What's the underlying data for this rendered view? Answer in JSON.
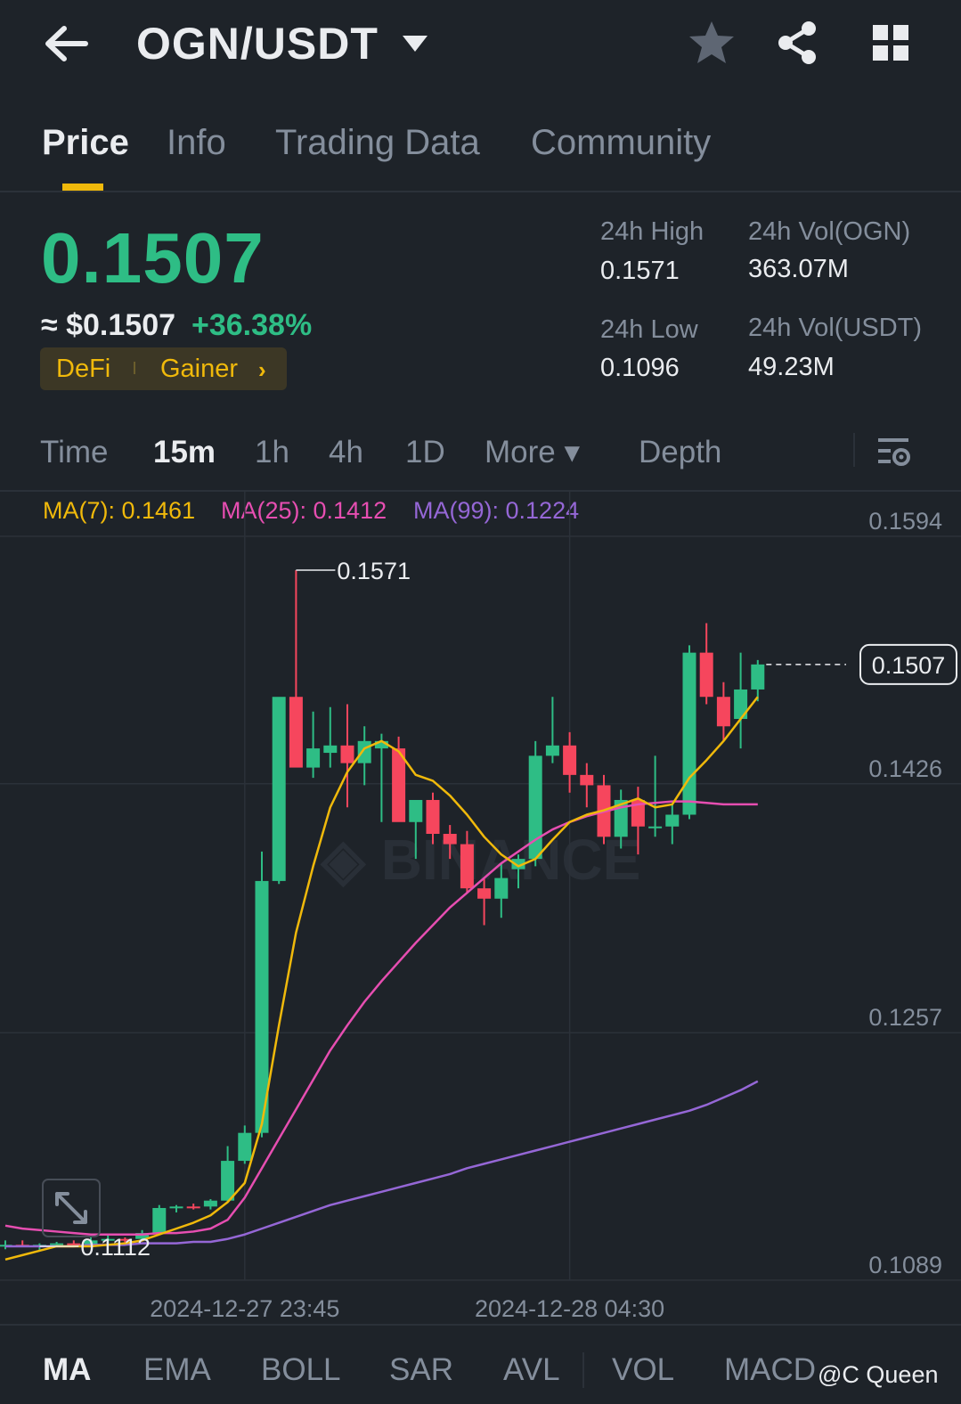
{
  "header": {
    "pair": "OGN/USDT",
    "icons": [
      "back-arrow-icon",
      "dropdown-caret-icon",
      "star-icon",
      "share-icon",
      "grid-menu-icon"
    ]
  },
  "tabs": [
    {
      "label": "Price",
      "active": true
    },
    {
      "label": "Info",
      "active": false
    },
    {
      "label": "Trading Data",
      "active": false
    },
    {
      "label": "Community",
      "active": false
    }
  ],
  "price": {
    "last": "0.1507",
    "usd": "≈ $0.1507",
    "change": "+36.38%",
    "tags": [
      "DeFi",
      "Gainer"
    ],
    "tag_chevron": "›"
  },
  "stats": {
    "high_label": "24h High",
    "high_value": "0.1571",
    "low_label": "24h Low",
    "low_value": "0.1096",
    "vol_base_label": "24h Vol(OGN)",
    "vol_base_value": "363.07M",
    "vol_quote_label": "24h Vol(USDT)",
    "vol_quote_value": "49.23M"
  },
  "intervals": [
    {
      "label": "Time",
      "active": false
    },
    {
      "label": "15m",
      "active": true
    },
    {
      "label": "1h",
      "active": false
    },
    {
      "label": "4h",
      "active": false
    },
    {
      "label": "1D",
      "active": false
    },
    {
      "label": "More ▾",
      "active": false
    },
    {
      "label": "Depth",
      "active": false
    }
  ],
  "ma_legend": {
    "ma7": "MA(7): 0.1461",
    "ma25": "MA(25): 0.1412",
    "ma99": "MA(99): 0.1224"
  },
  "colors": {
    "up": "#2ebd85",
    "down": "#f6465d",
    "accent": "#f0b90b",
    "ma7": "#f0b90b",
    "ma25": "#e64eb1",
    "ma99": "#9567d6",
    "bg": "#1e2329",
    "muted": "#848e9c"
  },
  "chart_data": {
    "type": "candlestick",
    "interval": "15m",
    "y_axis_ticks": [
      "0.1594",
      "0.1426",
      "0.1257",
      "0.1089"
    ],
    "ylim": [
      0.1089,
      0.1594
    ],
    "x_axis_ticks": [
      "2024-12-27 23:45",
      "2024-12-28 04:30"
    ],
    "x_tick_candle_index": [
      14,
      33
    ],
    "annotations": {
      "high": "0.1571",
      "low": "0.1112",
      "last": "0.1507"
    },
    "high_candle_index": 17,
    "low_candle_index": 2,
    "candles": [
      {
        "o": 0.1112,
        "h": 0.1116,
        "l": 0.111,
        "c": 0.1113
      },
      {
        "o": 0.1113,
        "h": 0.1116,
        "l": 0.1112,
        "c": 0.1112
      },
      {
        "o": 0.1112,
        "h": 0.1114,
        "l": 0.1109,
        "c": 0.1113
      },
      {
        "o": 0.1113,
        "h": 0.1115,
        "l": 0.1112,
        "c": 0.1114
      },
      {
        "o": 0.1114,
        "h": 0.1116,
        "l": 0.1112,
        "c": 0.1113
      },
      {
        "o": 0.1113,
        "h": 0.1118,
        "l": 0.1112,
        "c": 0.1116
      },
      {
        "o": 0.1116,
        "h": 0.112,
        "l": 0.1114,
        "c": 0.1117
      },
      {
        "o": 0.1117,
        "h": 0.1118,
        "l": 0.1114,
        "c": 0.1116
      },
      {
        "o": 0.1117,
        "h": 0.1123,
        "l": 0.1116,
        "c": 0.1121
      },
      {
        "o": 0.1121,
        "h": 0.114,
        "l": 0.112,
        "c": 0.1138
      },
      {
        "o": 0.1138,
        "h": 0.114,
        "l": 0.1135,
        "c": 0.1139
      },
      {
        "o": 0.1139,
        "h": 0.1141,
        "l": 0.1137,
        "c": 0.1138
      },
      {
        "o": 0.1139,
        "h": 0.1144,
        "l": 0.1137,
        "c": 0.1143
      },
      {
        "o": 0.1143,
        "h": 0.118,
        "l": 0.1142,
        "c": 0.117
      },
      {
        "o": 0.117,
        "h": 0.1194,
        "l": 0.1168,
        "c": 0.1189
      },
      {
        "o": 0.1189,
        "h": 0.138,
        "l": 0.1186,
        "c": 0.136
      },
      {
        "o": 0.136,
        "h": 0.1475,
        "l": 0.1358,
        "c": 0.1485
      },
      {
        "o": 0.1485,
        "h": 0.1571,
        "l": 0.144,
        "c": 0.1437
      },
      {
        "o": 0.1437,
        "h": 0.1475,
        "l": 0.143,
        "c": 0.145
      },
      {
        "o": 0.1447,
        "h": 0.1478,
        "l": 0.1437,
        "c": 0.1452
      },
      {
        "o": 0.1452,
        "h": 0.148,
        "l": 0.141,
        "c": 0.144
      },
      {
        "o": 0.144,
        "h": 0.1465,
        "l": 0.1425,
        "c": 0.1455
      },
      {
        "o": 0.145,
        "h": 0.146,
        "l": 0.14,
        "c": 0.1455
      },
      {
        "o": 0.145,
        "h": 0.1458,
        "l": 0.143,
        "c": 0.14
      },
      {
        "o": 0.14,
        "h": 0.1408,
        "l": 0.1375,
        "c": 0.1415
      },
      {
        "o": 0.1415,
        "h": 0.142,
        "l": 0.1385,
        "c": 0.1392
      },
      {
        "o": 0.1392,
        "h": 0.1398,
        "l": 0.1375,
        "c": 0.1385
      },
      {
        "o": 0.1385,
        "h": 0.1394,
        "l": 0.1352,
        "c": 0.1355
      },
      {
        "o": 0.1355,
        "h": 0.1362,
        "l": 0.133,
        "c": 0.1348
      },
      {
        "o": 0.1348,
        "h": 0.1372,
        "l": 0.1335,
        "c": 0.1362
      },
      {
        "o": 0.1368,
        "h": 0.1378,
        "l": 0.1355,
        "c": 0.1375
      },
      {
        "o": 0.1375,
        "h": 0.1455,
        "l": 0.137,
        "c": 0.1445
      },
      {
        "o": 0.1445,
        "h": 0.1485,
        "l": 0.144,
        "c": 0.1452
      },
      {
        "o": 0.1452,
        "h": 0.1461,
        "l": 0.142,
        "c": 0.1432
      },
      {
        "o": 0.1432,
        "h": 0.144,
        "l": 0.141,
        "c": 0.1425
      },
      {
        "o": 0.1425,
        "h": 0.1432,
        "l": 0.1385,
        "c": 0.139
      },
      {
        "o": 0.139,
        "h": 0.1422,
        "l": 0.1382,
        "c": 0.1415
      },
      {
        "o": 0.1415,
        "h": 0.1424,
        "l": 0.1378,
        "c": 0.1397
      },
      {
        "o": 0.1397,
        "h": 0.1445,
        "l": 0.139,
        "c": 0.1397
      },
      {
        "o": 0.1397,
        "h": 0.1412,
        "l": 0.1385,
        "c": 0.1405
      },
      {
        "o": 0.1405,
        "h": 0.152,
        "l": 0.1402,
        "c": 0.1515
      },
      {
        "o": 0.1515,
        "h": 0.1535,
        "l": 0.148,
        "c": 0.1485
      },
      {
        "o": 0.1485,
        "h": 0.1495,
        "l": 0.1455,
        "c": 0.1465
      },
      {
        "o": 0.147,
        "h": 0.1515,
        "l": 0.145,
        "c": 0.149
      },
      {
        "o": 0.149,
        "h": 0.151,
        "l": 0.1482,
        "c": 0.1507
      }
    ],
    "ma7": [
      0.1103,
      0.1106,
      0.1109,
      0.1112,
      0.1112,
      0.1112,
      0.1113,
      0.1114,
      0.1116,
      0.112,
      0.1124,
      0.1128,
      0.1133,
      0.1142,
      0.1155,
      0.1195,
      0.1262,
      0.1325,
      0.137,
      0.141,
      0.1434,
      0.145,
      0.1455,
      0.1448,
      0.1432,
      0.1428,
      0.1418,
      0.1405,
      0.139,
      0.1378,
      0.137,
      0.1375,
      0.1388,
      0.14,
      0.1405,
      0.1408,
      0.1412,
      0.1416,
      0.141,
      0.1412,
      0.143,
      0.1442,
      0.1455,
      0.147,
      0.1485
    ],
    "ma25": [
      0.1126,
      0.1124,
      0.1123,
      0.1122,
      0.1121,
      0.112,
      0.112,
      0.112,
      0.112,
      0.1121,
      0.1121,
      0.1122,
      0.1124,
      0.113,
      0.1145,
      0.1165,
      0.1185,
      0.1205,
      0.1225,
      0.1245,
      0.1262,
      0.1278,
      0.1292,
      0.1305,
      0.1318,
      0.133,
      0.1342,
      0.1352,
      0.1362,
      0.1372,
      0.138,
      0.1388,
      0.1395,
      0.14,
      0.1404,
      0.1407,
      0.141,
      0.1412,
      0.1413,
      0.1414,
      0.1414,
      0.1413,
      0.1412,
      0.1412,
      0.1412
    ],
    "ma99": [
      0.1112,
      0.1112,
      0.1112,
      0.1112,
      0.1112,
      0.1113,
      0.1113,
      0.1113,
      0.1114,
      0.1114,
      0.1114,
      0.1115,
      0.1115,
      0.1117,
      0.112,
      0.1124,
      0.1128,
      0.1132,
      0.1136,
      0.114,
      0.1143,
      0.1146,
      0.1149,
      0.1152,
      0.1155,
      0.1158,
      0.1161,
      0.1165,
      0.1168,
      0.1171,
      0.1174,
      0.1177,
      0.118,
      0.1183,
      0.1186,
      0.1189,
      0.1192,
      0.1195,
      0.1198,
      0.1201,
      0.1204,
      0.1208,
      0.1213,
      0.1218,
      0.1224
    ]
  },
  "indicators": [
    {
      "label": "MA",
      "active": true
    },
    {
      "label": "EMA",
      "active": false
    },
    {
      "label": "BOLL",
      "active": false
    },
    {
      "label": "SAR",
      "active": false
    },
    {
      "label": "AVL",
      "active": false
    },
    {
      "label": "VOL",
      "active": false
    },
    {
      "label": "MACD",
      "active": false
    }
  ],
  "watermark": "@C Queen"
}
